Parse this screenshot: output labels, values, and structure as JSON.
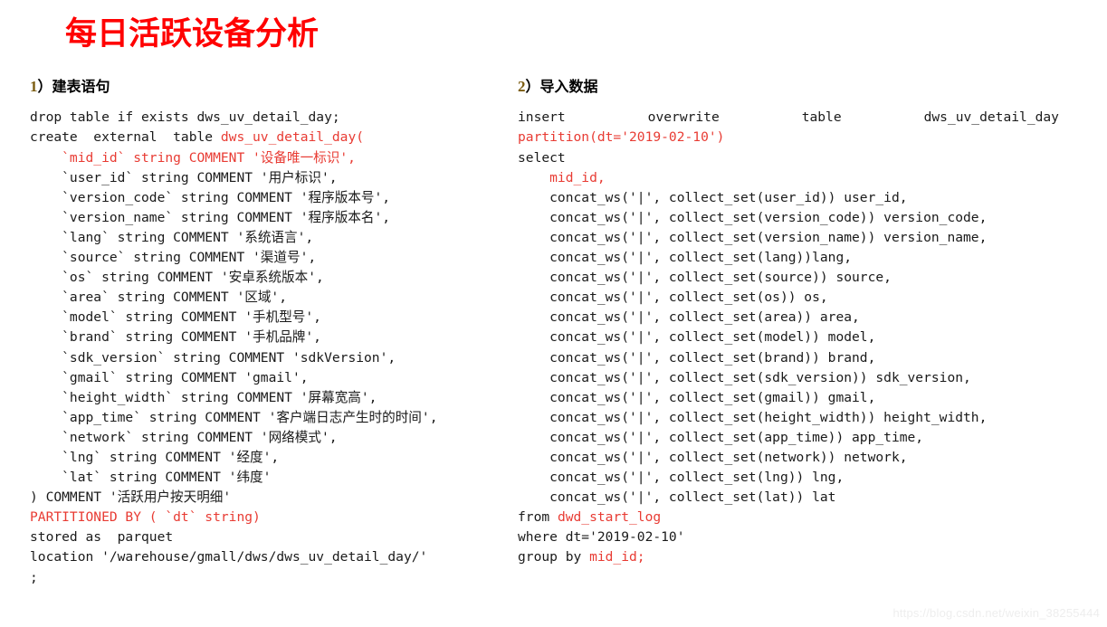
{
  "slide": {
    "title": "每日活跃设备分析",
    "title_color": "#ff0000",
    "background_color": "#ffffff",
    "code_red": "#e83b33",
    "code_black": "#1a1a1a",
    "heading_number_color": "#7b5c10"
  },
  "left": {
    "heading_number": "1",
    "heading_paren_text": "）建表语句",
    "code_lines": [
      {
        "segments": [
          {
            "text": "drop table if exists dws_uv_detail_day;",
            "color": "black"
          }
        ]
      },
      {
        "segments": [
          {
            "text": "create  external  table ",
            "color": "black"
          },
          {
            "text": "dws_uv_detail_day(",
            "color": "red"
          }
        ]
      },
      {
        "segments": [
          {
            "text": "    `mid_id` string COMMENT '设备唯一标识',",
            "color": "red"
          }
        ]
      },
      {
        "segments": [
          {
            "text": "    `user_id` string COMMENT '用户标识',",
            "color": "black"
          }
        ]
      },
      {
        "segments": [
          {
            "text": "    `version_code` string COMMENT '程序版本号',",
            "color": "black"
          }
        ]
      },
      {
        "segments": [
          {
            "text": "    `version_name` string COMMENT '程序版本名',",
            "color": "black"
          }
        ]
      },
      {
        "segments": [
          {
            "text": "    `lang` string COMMENT '系统语言',",
            "color": "black"
          }
        ]
      },
      {
        "segments": [
          {
            "text": "    `source` string COMMENT '渠道号',",
            "color": "black"
          }
        ]
      },
      {
        "segments": [
          {
            "text": "    `os` string COMMENT '安卓系统版本',",
            "color": "black"
          }
        ]
      },
      {
        "segments": [
          {
            "text": "    `area` string COMMENT '区域',",
            "color": "black"
          }
        ]
      },
      {
        "segments": [
          {
            "text": "    `model` string COMMENT '手机型号',",
            "color": "black"
          }
        ]
      },
      {
        "segments": [
          {
            "text": "    `brand` string COMMENT '手机品牌',",
            "color": "black"
          }
        ]
      },
      {
        "segments": [
          {
            "text": "    `sdk_version` string COMMENT 'sdkVersion',",
            "color": "black"
          }
        ]
      },
      {
        "segments": [
          {
            "text": "    `gmail` string COMMENT 'gmail',",
            "color": "black"
          }
        ]
      },
      {
        "segments": [
          {
            "text": "    `height_width` string COMMENT '屏幕宽高',",
            "color": "black"
          }
        ]
      },
      {
        "segments": [
          {
            "text": "    `app_time` string COMMENT '客户端日志产生时的时间',",
            "color": "black"
          }
        ]
      },
      {
        "segments": [
          {
            "text": "    `network` string COMMENT '网络模式',",
            "color": "black"
          }
        ]
      },
      {
        "segments": [
          {
            "text": "    `lng` string COMMENT '经度',",
            "color": "black"
          }
        ]
      },
      {
        "segments": [
          {
            "text": "    `lat` string COMMENT '纬度'",
            "color": "black"
          }
        ]
      },
      {
        "segments": [
          {
            "text": ") COMMENT '活跃用户按天明细'",
            "color": "black"
          }
        ]
      },
      {
        "segments": [
          {
            "text": "PARTITIONED BY ( `dt` string)",
            "color": "red"
          }
        ]
      },
      {
        "segments": [
          {
            "text": "stored as  parquet",
            "color": "black"
          }
        ]
      },
      {
        "segments": [
          {
            "text": "location '/warehouse/gmall/dws/dws_uv_detail_day/'",
            "color": "black"
          }
        ]
      },
      {
        "segments": [
          {
            "text": ";",
            "color": "black"
          }
        ]
      }
    ]
  },
  "right": {
    "heading_number": "2",
    "heading_paren_text": "）导入数据",
    "first_line_justified": [
      {
        "text": "insert",
        "color": "black"
      },
      {
        "text": "overwrite",
        "color": "black"
      },
      {
        "text": "table",
        "color": "black"
      },
      {
        "text": "dws_uv_detail_day",
        "color": "black"
      }
    ],
    "code_lines": [
      {
        "segments": [
          {
            "text": "partition(dt='2019-02-10')",
            "color": "red"
          }
        ]
      },
      {
        "segments": [
          {
            "text": "select",
            "color": "black"
          }
        ]
      },
      {
        "segments": [
          {
            "text": "    mid_id,",
            "color": "red"
          }
        ]
      },
      {
        "segments": [
          {
            "text": "    concat_ws('|', collect_set(user_id)) user_id,",
            "color": "black"
          }
        ]
      },
      {
        "segments": [
          {
            "text": "    concat_ws('|', collect_set(version_code)) version_code,",
            "color": "black"
          }
        ]
      },
      {
        "segments": [
          {
            "text": "    concat_ws('|', collect_set(version_name)) version_name,",
            "color": "black"
          }
        ]
      },
      {
        "segments": [
          {
            "text": "    concat_ws('|', collect_set(lang))lang,",
            "color": "black"
          }
        ]
      },
      {
        "segments": [
          {
            "text": "    concat_ws('|', collect_set(source)) source,",
            "color": "black"
          }
        ]
      },
      {
        "segments": [
          {
            "text": "    concat_ws('|', collect_set(os)) os,",
            "color": "black"
          }
        ]
      },
      {
        "segments": [
          {
            "text": "    concat_ws('|', collect_set(area)) area,",
            "color": "black"
          }
        ]
      },
      {
        "segments": [
          {
            "text": "    concat_ws('|', collect_set(model)) model,",
            "color": "black"
          }
        ]
      },
      {
        "segments": [
          {
            "text": "    concat_ws('|', collect_set(brand)) brand,",
            "color": "black"
          }
        ]
      },
      {
        "segments": [
          {
            "text": "    concat_ws('|', collect_set(sdk_version)) sdk_version,",
            "color": "black"
          }
        ]
      },
      {
        "segments": [
          {
            "text": "    concat_ws('|', collect_set(gmail)) gmail,",
            "color": "black"
          }
        ]
      },
      {
        "segments": [
          {
            "text": "    concat_ws('|', collect_set(height_width)) height_width,",
            "color": "black"
          }
        ]
      },
      {
        "segments": [
          {
            "text": "    concat_ws('|', collect_set(app_time)) app_time,",
            "color": "black"
          }
        ]
      },
      {
        "segments": [
          {
            "text": "    concat_ws('|', collect_set(network)) network,",
            "color": "black"
          }
        ]
      },
      {
        "segments": [
          {
            "text": "    concat_ws('|', collect_set(lng)) lng,",
            "color": "black"
          }
        ]
      },
      {
        "segments": [
          {
            "text": "    concat_ws('|', collect_set(lat)) lat",
            "color": "black"
          }
        ]
      },
      {
        "segments": [
          {
            "text": "from ",
            "color": "black"
          },
          {
            "text": "dwd_start_log",
            "color": "red"
          }
        ]
      },
      {
        "segments": [
          {
            "text": "where dt='2019-02-10'",
            "color": "black"
          }
        ]
      },
      {
        "segments": [
          {
            "text": "group by ",
            "color": "black"
          },
          {
            "text": "mid_id;",
            "color": "red"
          }
        ]
      }
    ]
  },
  "watermark": {
    "text": "https://blog.csdn.net/weixin_38255444"
  }
}
